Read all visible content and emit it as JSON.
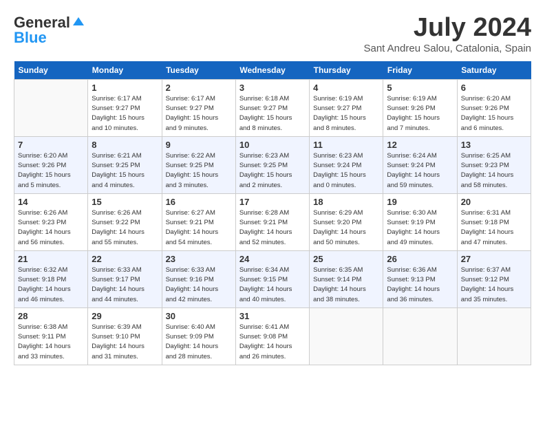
{
  "header": {
    "logo_general": "General",
    "logo_blue": "Blue",
    "month_year": "July 2024",
    "location": "Sant Andreu Salou, Catalonia, Spain"
  },
  "days_of_week": [
    "Sunday",
    "Monday",
    "Tuesday",
    "Wednesday",
    "Thursday",
    "Friday",
    "Saturday"
  ],
  "weeks": [
    [
      {
        "day": "",
        "info": ""
      },
      {
        "day": "1",
        "info": "Sunrise: 6:17 AM\nSunset: 9:27 PM\nDaylight: 15 hours\nand 10 minutes."
      },
      {
        "day": "2",
        "info": "Sunrise: 6:17 AM\nSunset: 9:27 PM\nDaylight: 15 hours\nand 9 minutes."
      },
      {
        "day": "3",
        "info": "Sunrise: 6:18 AM\nSunset: 9:27 PM\nDaylight: 15 hours\nand 8 minutes."
      },
      {
        "day": "4",
        "info": "Sunrise: 6:19 AM\nSunset: 9:27 PM\nDaylight: 15 hours\nand 8 minutes."
      },
      {
        "day": "5",
        "info": "Sunrise: 6:19 AM\nSunset: 9:26 PM\nDaylight: 15 hours\nand 7 minutes."
      },
      {
        "day": "6",
        "info": "Sunrise: 6:20 AM\nSunset: 9:26 PM\nDaylight: 15 hours\nand 6 minutes."
      }
    ],
    [
      {
        "day": "7",
        "info": "Sunrise: 6:20 AM\nSunset: 9:26 PM\nDaylight: 15 hours\nand 5 minutes."
      },
      {
        "day": "8",
        "info": "Sunrise: 6:21 AM\nSunset: 9:25 PM\nDaylight: 15 hours\nand 4 minutes."
      },
      {
        "day": "9",
        "info": "Sunrise: 6:22 AM\nSunset: 9:25 PM\nDaylight: 15 hours\nand 3 minutes."
      },
      {
        "day": "10",
        "info": "Sunrise: 6:23 AM\nSunset: 9:25 PM\nDaylight: 15 hours\nand 2 minutes."
      },
      {
        "day": "11",
        "info": "Sunrise: 6:23 AM\nSunset: 9:24 PM\nDaylight: 15 hours\nand 0 minutes."
      },
      {
        "day": "12",
        "info": "Sunrise: 6:24 AM\nSunset: 9:24 PM\nDaylight: 14 hours\nand 59 minutes."
      },
      {
        "day": "13",
        "info": "Sunrise: 6:25 AM\nSunset: 9:23 PM\nDaylight: 14 hours\nand 58 minutes."
      }
    ],
    [
      {
        "day": "14",
        "info": "Sunrise: 6:26 AM\nSunset: 9:23 PM\nDaylight: 14 hours\nand 56 minutes."
      },
      {
        "day": "15",
        "info": "Sunrise: 6:26 AM\nSunset: 9:22 PM\nDaylight: 14 hours\nand 55 minutes."
      },
      {
        "day": "16",
        "info": "Sunrise: 6:27 AM\nSunset: 9:21 PM\nDaylight: 14 hours\nand 54 minutes."
      },
      {
        "day": "17",
        "info": "Sunrise: 6:28 AM\nSunset: 9:21 PM\nDaylight: 14 hours\nand 52 minutes."
      },
      {
        "day": "18",
        "info": "Sunrise: 6:29 AM\nSunset: 9:20 PM\nDaylight: 14 hours\nand 50 minutes."
      },
      {
        "day": "19",
        "info": "Sunrise: 6:30 AM\nSunset: 9:19 PM\nDaylight: 14 hours\nand 49 minutes."
      },
      {
        "day": "20",
        "info": "Sunrise: 6:31 AM\nSunset: 9:18 PM\nDaylight: 14 hours\nand 47 minutes."
      }
    ],
    [
      {
        "day": "21",
        "info": "Sunrise: 6:32 AM\nSunset: 9:18 PM\nDaylight: 14 hours\nand 46 minutes."
      },
      {
        "day": "22",
        "info": "Sunrise: 6:33 AM\nSunset: 9:17 PM\nDaylight: 14 hours\nand 44 minutes."
      },
      {
        "day": "23",
        "info": "Sunrise: 6:33 AM\nSunset: 9:16 PM\nDaylight: 14 hours\nand 42 minutes."
      },
      {
        "day": "24",
        "info": "Sunrise: 6:34 AM\nSunset: 9:15 PM\nDaylight: 14 hours\nand 40 minutes."
      },
      {
        "day": "25",
        "info": "Sunrise: 6:35 AM\nSunset: 9:14 PM\nDaylight: 14 hours\nand 38 minutes."
      },
      {
        "day": "26",
        "info": "Sunrise: 6:36 AM\nSunset: 9:13 PM\nDaylight: 14 hours\nand 36 minutes."
      },
      {
        "day": "27",
        "info": "Sunrise: 6:37 AM\nSunset: 9:12 PM\nDaylight: 14 hours\nand 35 minutes."
      }
    ],
    [
      {
        "day": "28",
        "info": "Sunrise: 6:38 AM\nSunset: 9:11 PM\nDaylight: 14 hours\nand 33 minutes."
      },
      {
        "day": "29",
        "info": "Sunrise: 6:39 AM\nSunset: 9:10 PM\nDaylight: 14 hours\nand 31 minutes."
      },
      {
        "day": "30",
        "info": "Sunrise: 6:40 AM\nSunset: 9:09 PM\nDaylight: 14 hours\nand 28 minutes."
      },
      {
        "day": "31",
        "info": "Sunrise: 6:41 AM\nSunset: 9:08 PM\nDaylight: 14 hours\nand 26 minutes."
      },
      {
        "day": "",
        "info": ""
      },
      {
        "day": "",
        "info": ""
      },
      {
        "day": "",
        "info": ""
      }
    ]
  ]
}
